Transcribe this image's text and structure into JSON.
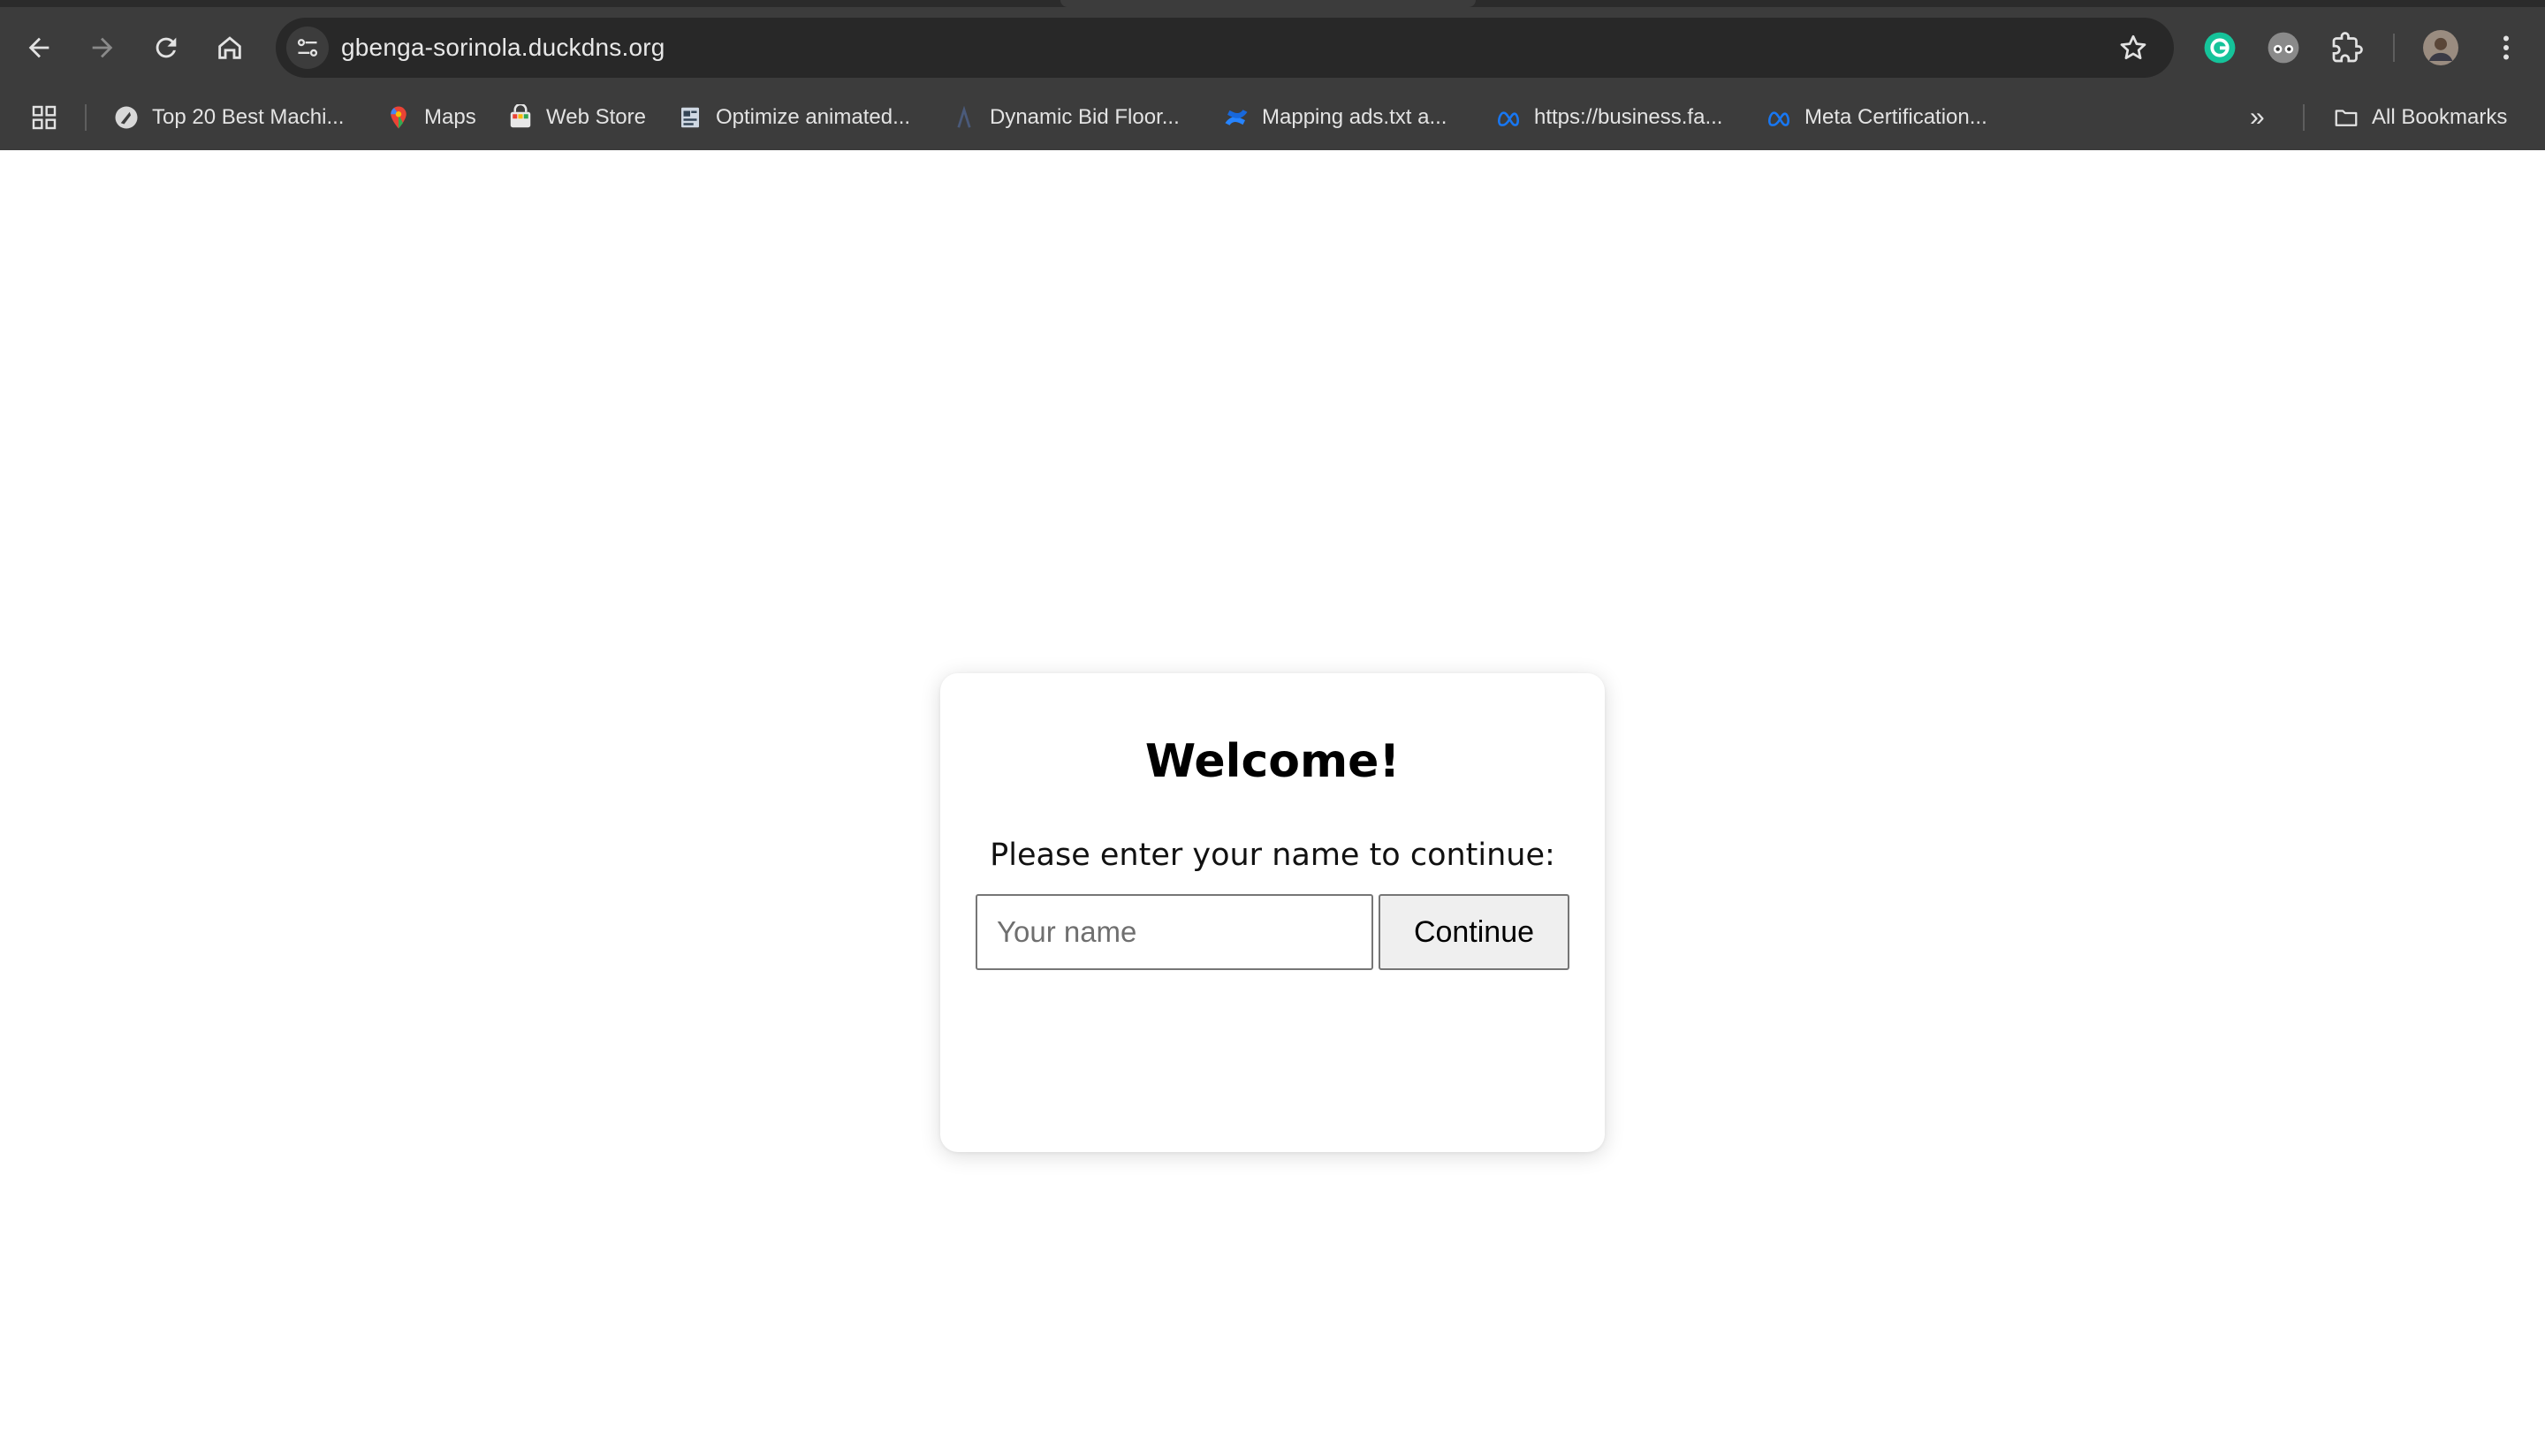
{
  "browser": {
    "url": "gbenga-sorinola.duckdns.org",
    "toolbar_icons": [
      "back-arrow-icon",
      "forward-arrow-icon",
      "reload-icon",
      "home-icon",
      "site-info-icon",
      "bookmark-star-icon",
      "grammarly-icon",
      "incognito-glasses-icon",
      "extensions-puzzle-icon",
      "profile-avatar",
      "kebab-menu-icon"
    ],
    "bookmarks": [
      {
        "label": "Top 20 Best Machi...",
        "icon": "feather-circle-icon"
      },
      {
        "label": "Maps",
        "icon": "maps-pin-icon"
      },
      {
        "label": "Web Store",
        "icon": "web-store-icon"
      },
      {
        "label": "Optimize animated...",
        "icon": "document-icon"
      },
      {
        "label": "Dynamic Bid Floor...",
        "icon": "lambda-icon"
      },
      {
        "label": "Mapping ads.txt a...",
        "icon": "confluence-icon"
      },
      {
        "label": "https://business.fa...",
        "icon": "meta-icon"
      },
      {
        "label": "Meta Certification...",
        "icon": "meta-icon"
      }
    ],
    "all_bookmarks_label": "All Bookmarks",
    "overflow_label": "»"
  },
  "welcome": {
    "title": "Welcome!",
    "prompt": "Please enter your name to continue:",
    "input_placeholder": "Your name",
    "input_value": "",
    "button_label": "Continue"
  },
  "colors": {
    "chrome_bg": "#3c3c3c",
    "omnibox_bg": "#282828",
    "page_bg": "#ffffff",
    "button_bg": "#efefef"
  }
}
